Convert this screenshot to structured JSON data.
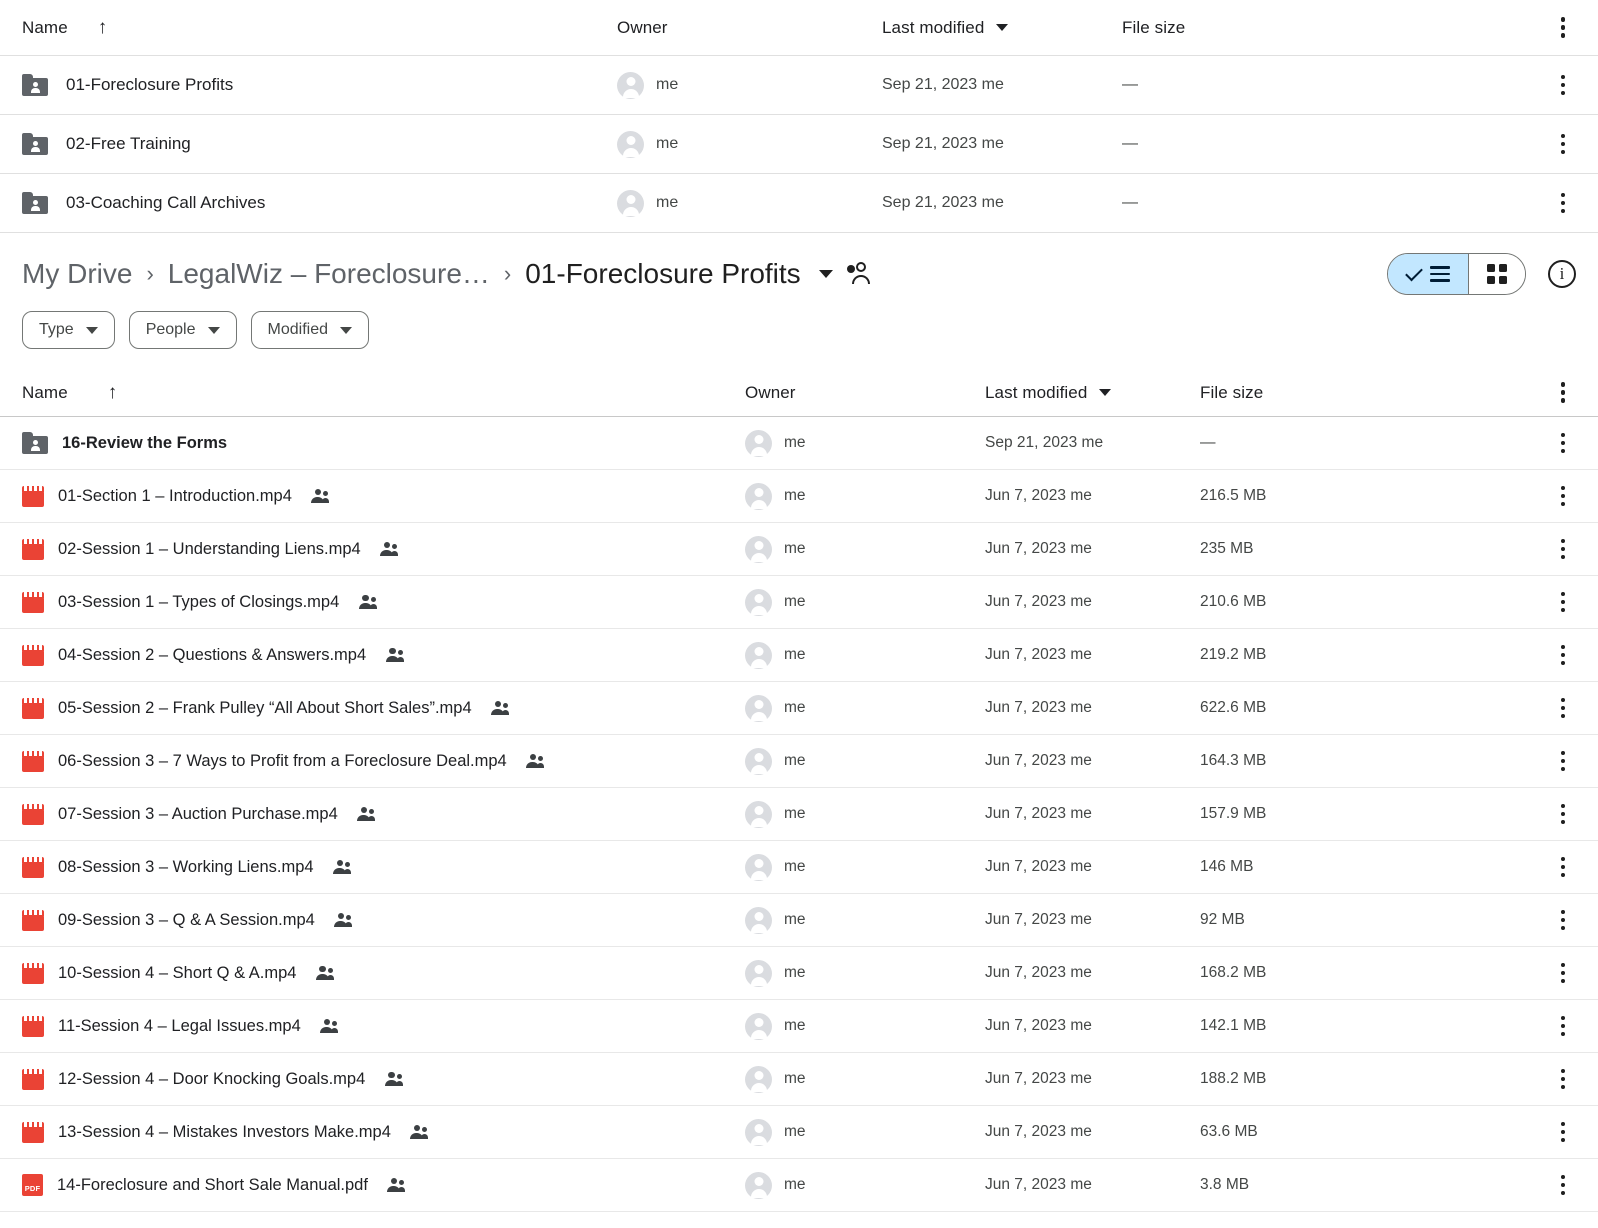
{
  "top_table": {
    "columns": {
      "name": "Name",
      "owner": "Owner",
      "modified": "Last modified",
      "size": "File size"
    },
    "rows": [
      {
        "name": "01-Foreclosure Profits",
        "icon": "shared-folder-icon",
        "owner": "me",
        "modified": "Sep 21, 2023 me",
        "size": "—"
      },
      {
        "name": "02-Free Training",
        "icon": "shared-folder-icon",
        "owner": "me",
        "modified": "Sep 21, 2023 me",
        "size": "—"
      },
      {
        "name": "03-Coaching Call Archives",
        "icon": "shared-folder-icon",
        "owner": "me",
        "modified": "Sep 21, 2023 me",
        "size": "—"
      }
    ]
  },
  "breadcrumb": {
    "root": "My Drive",
    "parent": "LegalWiz – Foreclosure…",
    "current": "01-Foreclosure Profits",
    "separator": "›",
    "share_icon": "people-icon",
    "caret_icon": "chevron-down-icon"
  },
  "view_toggle": {
    "list_label": "list-view",
    "grid_label": "grid-view",
    "active": "list",
    "info_label": "i",
    "active_bg": "#c2e7ff"
  },
  "filters": [
    {
      "label": "Type"
    },
    {
      "label": "People"
    },
    {
      "label": "Modified"
    }
  ],
  "files_table": {
    "columns": {
      "name": "Name",
      "owner": "Owner",
      "modified": "Last modified",
      "size": "File size"
    },
    "rows": [
      {
        "name": "16-Review the Forms",
        "type": "folder",
        "shared": false,
        "owner": "me",
        "modified": "Sep 21, 2023 me",
        "size": "—"
      },
      {
        "name": "01-Section 1 – Introduction.mp4",
        "type": "video",
        "shared": true,
        "owner": "me",
        "modified": "Jun 7, 2023 me",
        "size": "216.5 MB"
      },
      {
        "name": "02-Session 1 – Understanding Liens.mp4",
        "type": "video",
        "shared": true,
        "owner": "me",
        "modified": "Jun 7, 2023 me",
        "size": "235 MB"
      },
      {
        "name": "03-Session 1 – Types of Closings.mp4",
        "type": "video",
        "shared": true,
        "owner": "me",
        "modified": "Jun 7, 2023 me",
        "size": "210.6 MB"
      },
      {
        "name": "04-Session 2 – Questions & Answers.mp4",
        "type": "video",
        "shared": true,
        "owner": "me",
        "modified": "Jun 7, 2023 me",
        "size": "219.2 MB"
      },
      {
        "name": "05-Session 2 – Frank Pulley “All About Short Sales”.mp4",
        "type": "video",
        "shared": true,
        "owner": "me",
        "modified": "Jun 7, 2023 me",
        "size": "622.6 MB"
      },
      {
        "name": "06-Session 3 – 7 Ways to Profit from a Foreclosure Deal.mp4",
        "type": "video",
        "shared": true,
        "owner": "me",
        "modified": "Jun 7, 2023 me",
        "size": "164.3 MB"
      },
      {
        "name": "07-Session 3 – Auction Purchase.mp4",
        "type": "video",
        "shared": true,
        "owner": "me",
        "modified": "Jun 7, 2023 me",
        "size": "157.9 MB"
      },
      {
        "name": "08-Session 3 – Working Liens.mp4",
        "type": "video",
        "shared": true,
        "owner": "me",
        "modified": "Jun 7, 2023 me",
        "size": "146 MB"
      },
      {
        "name": "09-Session 3 – Q & A Session.mp4",
        "type": "video",
        "shared": true,
        "owner": "me",
        "modified": "Jun 7, 2023 me",
        "size": "92 MB"
      },
      {
        "name": "10-Session 4 – Short Q & A.mp4",
        "type": "video",
        "shared": true,
        "owner": "me",
        "modified": "Jun 7, 2023 me",
        "size": "168.2 MB"
      },
      {
        "name": "11-Session 4 – Legal Issues.mp4",
        "type": "video",
        "shared": true,
        "owner": "me",
        "modified": "Jun 7, 2023 me",
        "size": "142.1 MB"
      },
      {
        "name": "12-Session 4 – Door Knocking Goals.mp4",
        "type": "video",
        "shared": true,
        "owner": "me",
        "modified": "Jun 7, 2023 me",
        "size": "188.2 MB"
      },
      {
        "name": "13-Session 4 – Mistakes Investors Make.mp4",
        "type": "video",
        "shared": true,
        "owner": "me",
        "modified": "Jun 7, 2023 me",
        "size": "63.6 MB"
      },
      {
        "name": "14-Foreclosure and Short Sale Manual.pdf",
        "type": "pdf",
        "shared": true,
        "owner": "me",
        "modified": "Jun 7, 2023 me",
        "size": "3.8 MB",
        "pdf_label": "PDF"
      }
    ]
  }
}
